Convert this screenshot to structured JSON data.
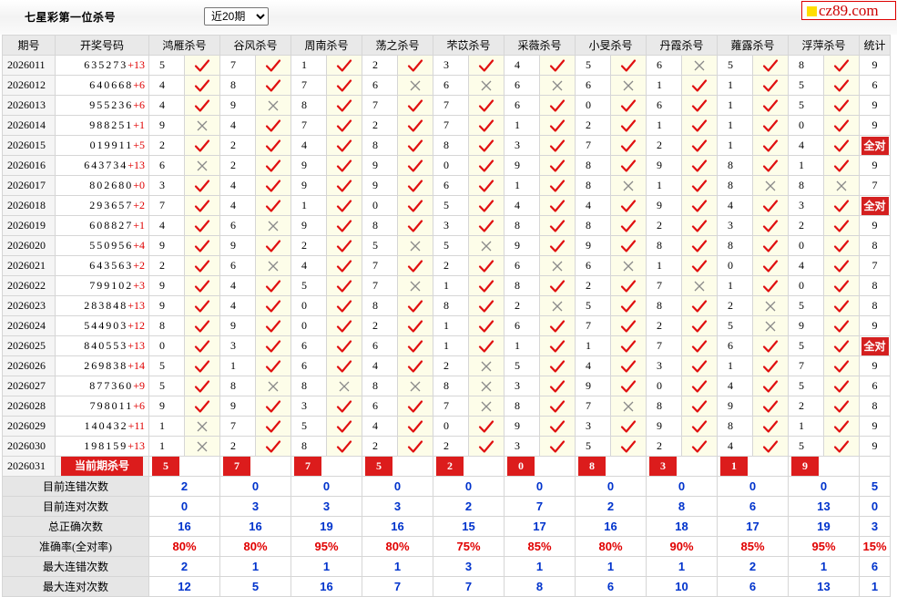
{
  "page_title": "七星彩第一位杀号",
  "period_select": "近20期",
  "logo_text": "cz89.com",
  "headers": [
    "期号",
    "开奖号码",
    "鸿雁杀号",
    "谷风杀号",
    "周南杀号",
    "荡之杀号",
    "芣苡杀号",
    "采薇杀号",
    "小旻杀号",
    "丹霞杀号",
    "蕹露杀号",
    "浮萍杀号",
    "统计"
  ],
  "rows": [
    {
      "id": "2026011",
      "digits": "635273",
      "sum": "+13",
      "k": [
        "5",
        "7",
        "1",
        "2",
        "3",
        "4",
        "5",
        "6",
        "5",
        "8"
      ],
      "ok": [
        1,
        1,
        1,
        1,
        1,
        1,
        1,
        0,
        1,
        1
      ],
      "stat": "9"
    },
    {
      "id": "2026012",
      "digits": "640668",
      "sum": "+6",
      "k": [
        "4",
        "8",
        "7",
        "6",
        "6",
        "6",
        "6",
        "1",
        "1",
        "5"
      ],
      "ok": [
        1,
        1,
        1,
        0,
        0,
        0,
        0,
        1,
        1,
        1
      ],
      "stat": "6"
    },
    {
      "id": "2026013",
      "digits": "955236",
      "sum": "+6",
      "k": [
        "4",
        "9",
        "8",
        "7",
        "7",
        "6",
        "0",
        "6",
        "1",
        "5"
      ],
      "ok": [
        1,
        0,
        1,
        1,
        1,
        1,
        1,
        1,
        1,
        1
      ],
      "stat": "9"
    },
    {
      "id": "2026014",
      "digits": "988251",
      "sum": "+1",
      "k": [
        "9",
        "4",
        "7",
        "2",
        "7",
        "1",
        "2",
        "1",
        "1",
        "0"
      ],
      "ok": [
        0,
        1,
        1,
        1,
        1,
        1,
        1,
        1,
        1,
        1
      ],
      "stat": "9"
    },
    {
      "id": "2026015",
      "digits": "019911",
      "sum": "+5",
      "k": [
        "2",
        "2",
        "4",
        "8",
        "8",
        "3",
        "7",
        "2",
        "1",
        "4"
      ],
      "ok": [
        1,
        1,
        1,
        1,
        1,
        1,
        1,
        1,
        1,
        1
      ],
      "stat": "全对"
    },
    {
      "id": "2026016",
      "digits": "643734",
      "sum": "+13",
      "k": [
        "6",
        "2",
        "9",
        "9",
        "0",
        "9",
        "8",
        "9",
        "8",
        "1"
      ],
      "ok": [
        0,
        1,
        1,
        1,
        1,
        1,
        1,
        1,
        1,
        1
      ],
      "stat": "9"
    },
    {
      "id": "2026017",
      "digits": "802680",
      "sum": "+0",
      "k": [
        "3",
        "4",
        "9",
        "9",
        "6",
        "1",
        "8",
        "1",
        "8",
        "8"
      ],
      "ok": [
        1,
        1,
        1,
        1,
        1,
        1,
        0,
        1,
        0,
        0
      ],
      "stat": "7"
    },
    {
      "id": "2026018",
      "digits": "293657",
      "sum": "+2",
      "k": [
        "7",
        "4",
        "1",
        "0",
        "5",
        "4",
        "4",
        "9",
        "4",
        "3"
      ],
      "ok": [
        1,
        1,
        1,
        1,
        1,
        1,
        1,
        1,
        1,
        1
      ],
      "stat": "全对"
    },
    {
      "id": "2026019",
      "digits": "608827",
      "sum": "+1",
      "k": [
        "4",
        "6",
        "9",
        "8",
        "3",
        "8",
        "8",
        "2",
        "3",
        "2"
      ],
      "ok": [
        1,
        0,
        1,
        1,
        1,
        1,
        1,
        1,
        1,
        1
      ],
      "stat": "9"
    },
    {
      "id": "2026020",
      "digits": "550956",
      "sum": "+4",
      "k": [
        "9",
        "9",
        "2",
        "5",
        "5",
        "9",
        "9",
        "8",
        "8",
        "0"
      ],
      "ok": [
        1,
        1,
        1,
        0,
        0,
        1,
        1,
        1,
        1,
        1
      ],
      "stat": "8"
    },
    {
      "id": "2026021",
      "digits": "643563",
      "sum": "+2",
      "k": [
        "2",
        "6",
        "4",
        "7",
        "2",
        "6",
        "6",
        "1",
        "0",
        "4"
      ],
      "ok": [
        1,
        0,
        1,
        1,
        1,
        0,
        0,
        1,
        1,
        1
      ],
      "stat": "7"
    },
    {
      "id": "2026022",
      "digits": "799102",
      "sum": "+3",
      "k": [
        "9",
        "4",
        "5",
        "7",
        "1",
        "8",
        "2",
        "7",
        "1",
        "0"
      ],
      "ok": [
        1,
        1,
        1,
        0,
        1,
        1,
        1,
        0,
        1,
        1
      ],
      "stat": "8"
    },
    {
      "id": "2026023",
      "digits": "283848",
      "sum": "+13",
      "k": [
        "9",
        "4",
        "0",
        "8",
        "8",
        "2",
        "5",
        "8",
        "2",
        "5"
      ],
      "ok": [
        1,
        1,
        1,
        1,
        1,
        0,
        1,
        1,
        0,
        1
      ],
      "stat": "8"
    },
    {
      "id": "2026024",
      "digits": "544903",
      "sum": "+12",
      "k": [
        "8",
        "9",
        "0",
        "2",
        "1",
        "6",
        "7",
        "2",
        "5",
        "9"
      ],
      "ok": [
        1,
        1,
        1,
        1,
        1,
        1,
        1,
        1,
        0,
        1
      ],
      "stat": "9"
    },
    {
      "id": "2026025",
      "digits": "840553",
      "sum": "+13",
      "k": [
        "0",
        "3",
        "6",
        "6",
        "1",
        "1",
        "1",
        "7",
        "6",
        "5"
      ],
      "ok": [
        1,
        1,
        1,
        1,
        1,
        1,
        1,
        1,
        1,
        1
      ],
      "stat": "全对"
    },
    {
      "id": "2026026",
      "digits": "269838",
      "sum": "+14",
      "k": [
        "5",
        "1",
        "6",
        "4",
        "2",
        "5",
        "4",
        "3",
        "1",
        "7"
      ],
      "ok": [
        1,
        1,
        1,
        1,
        0,
        1,
        1,
        1,
        1,
        1
      ],
      "stat": "9"
    },
    {
      "id": "2026027",
      "digits": "877360",
      "sum": "+9",
      "k": [
        "5",
        "8",
        "8",
        "8",
        "8",
        "3",
        "9",
        "0",
        "4",
        "5"
      ],
      "ok": [
        1,
        0,
        0,
        0,
        0,
        1,
        1,
        1,
        1,
        1
      ],
      "stat": "6"
    },
    {
      "id": "2026028",
      "digits": "798011",
      "sum": "+6",
      "k": [
        "9",
        "9",
        "3",
        "6",
        "7",
        "8",
        "7",
        "8",
        "9",
        "2"
      ],
      "ok": [
        1,
        1,
        1,
        1,
        0,
        1,
        0,
        1,
        1,
        1
      ],
      "stat": "8"
    },
    {
      "id": "2026029",
      "digits": "140432",
      "sum": "+11",
      "k": [
        "1",
        "7",
        "5",
        "4",
        "0",
        "9",
        "3",
        "9",
        "8",
        "1"
      ],
      "ok": [
        0,
        1,
        1,
        1,
        1,
        1,
        1,
        1,
        1,
        1
      ],
      "stat": "9"
    },
    {
      "id": "2026030",
      "digits": "198159",
      "sum": "+13",
      "k": [
        "1",
        "2",
        "8",
        "2",
        "2",
        "3",
        "5",
        "2",
        "4",
        "5"
      ],
      "ok": [
        0,
        1,
        1,
        1,
        1,
        1,
        1,
        1,
        1,
        1
      ],
      "stat": "9"
    }
  ],
  "current": {
    "id": "2026031",
    "label": "当前期杀号",
    "k": [
      "5",
      "7",
      "7",
      "5",
      "2",
      "0",
      "8",
      "3",
      "1",
      "9"
    ]
  },
  "stats": [
    {
      "label": "目前连错次数",
      "vals": [
        "2",
        "0",
        "0",
        "0",
        "0",
        "0",
        "0",
        "0",
        "0",
        "0",
        "5"
      ]
    },
    {
      "label": "目前连对次数",
      "vals": [
        "0",
        "3",
        "3",
        "3",
        "2",
        "7",
        "2",
        "8",
        "6",
        "13",
        "0"
      ]
    },
    {
      "label": "总正确次数",
      "vals": [
        "16",
        "16",
        "19",
        "16",
        "15",
        "17",
        "16",
        "18",
        "17",
        "19",
        "3"
      ]
    },
    {
      "label": "准确率(全对率)",
      "vals": [
        "80%",
        "80%",
        "95%",
        "80%",
        "75%",
        "85%",
        "80%",
        "90%",
        "85%",
        "95%",
        "15%"
      ],
      "red": true
    },
    {
      "label": "最大连错次数",
      "vals": [
        "2",
        "1",
        "1",
        "1",
        "3",
        "1",
        "1",
        "1",
        "2",
        "1",
        "6"
      ]
    },
    {
      "label": "最大连对次数",
      "vals": [
        "12",
        "5",
        "16",
        "7",
        "7",
        "8",
        "6",
        "10",
        "6",
        "13",
        "1"
      ]
    }
  ],
  "colors": {
    "accent": "#dc1c1c",
    "tick": "#e01010",
    "cross": "#8a8a8a",
    "stat_blue": "#0033cc"
  }
}
